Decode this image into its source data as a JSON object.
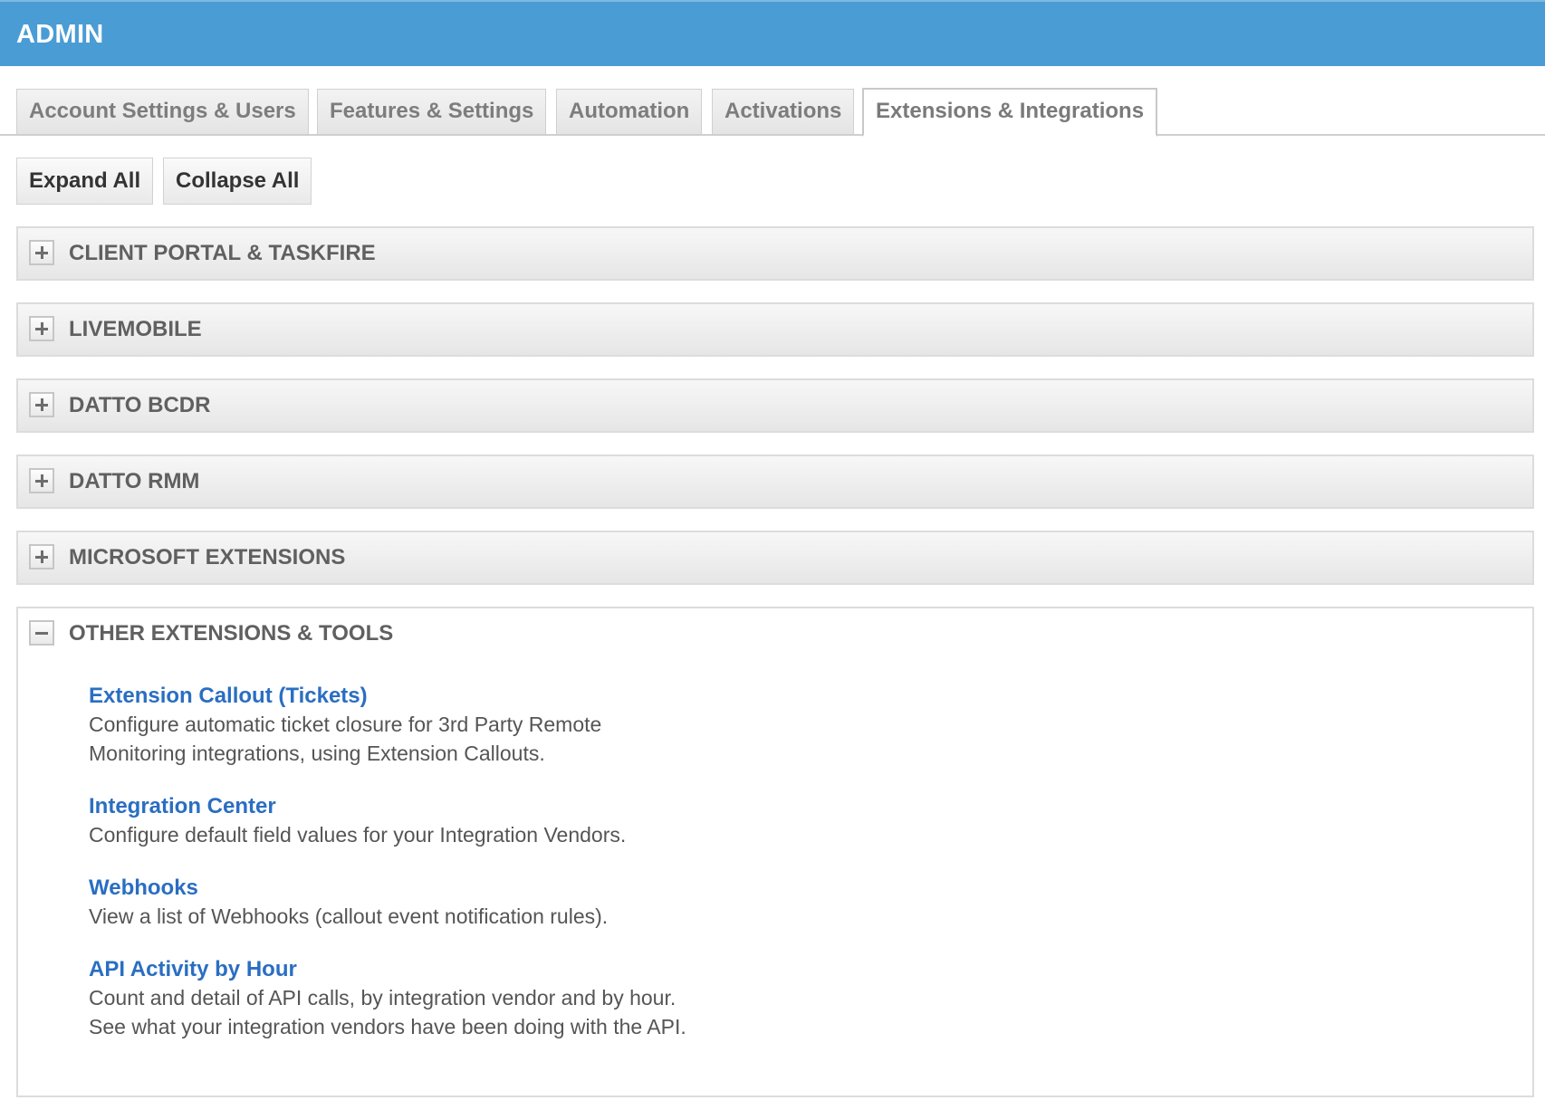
{
  "header": {
    "title": "ADMIN"
  },
  "tabs": [
    {
      "label": "Account Settings & Users"
    },
    {
      "label": "Features & Settings"
    },
    {
      "label": "Automation"
    },
    {
      "label": "Activations"
    },
    {
      "label": "Extensions & Integrations",
      "active": true
    }
  ],
  "toolbar": {
    "expand_label": "Expand All",
    "collapse_label": "Collapse All"
  },
  "sections": [
    {
      "title": "CLIENT PORTAL & TASKFIRE",
      "state": "collapsed"
    },
    {
      "title": "LIVEMOBILE",
      "state": "collapsed"
    },
    {
      "title": "DATTO BCDR",
      "state": "collapsed"
    },
    {
      "title": "DATTO RMM",
      "state": "collapsed"
    },
    {
      "title": "MICROSOFT EXTENSIONS",
      "state": "collapsed"
    },
    {
      "title": "OTHER EXTENSIONS & TOOLS",
      "state": "expanded",
      "items": [
        {
          "link": "Extension Callout (Tickets)",
          "desc": [
            "Configure automatic ticket closure for 3rd Party Remote",
            "Monitoring integrations, using Extension Callouts."
          ]
        },
        {
          "link": "Integration Center",
          "desc": [
            "Configure default field values for your Integration Vendors."
          ]
        },
        {
          "link": "Webhooks",
          "desc": [
            "View a list of Webhooks (callout event notification rules)."
          ]
        },
        {
          "link": "API Activity by Hour",
          "desc": [
            "Count and detail of API calls, by integration vendor and by hour.",
            "See what your integration vendors have been doing with the API."
          ]
        }
      ]
    }
  ],
  "icons": {
    "expand": "plus-icon",
    "collapse": "minus-icon"
  },
  "colors": {
    "header_bg": "#4a9cd4",
    "link": "#2a6ec2"
  }
}
